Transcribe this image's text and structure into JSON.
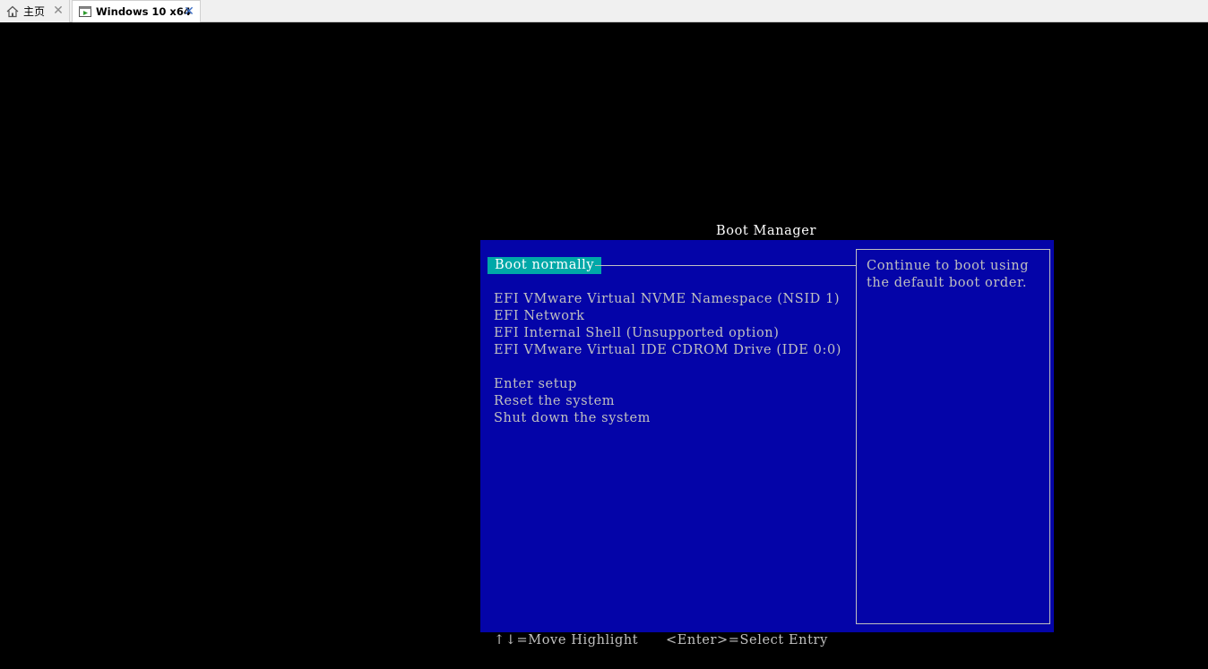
{
  "tabs": [
    {
      "label": "主页",
      "icon": "home-icon",
      "active": false
    },
    {
      "label": "Windows 10 x64",
      "icon": "vm-play-icon",
      "active": true
    }
  ],
  "tab_close_glyph": "✕",
  "boot_manager": {
    "title": "Boot Manager",
    "selected_item": "Boot normally",
    "boot_entries": [
      "EFI VMware Virtual NVME Namespace (NSID 1)",
      "EFI Network",
      "EFI Internal Shell (Unsupported option)",
      "EFI VMware Virtual IDE CDROM Drive (IDE 0:0)"
    ],
    "actions": [
      "Enter setup",
      "Reset the system",
      "Shut down the system"
    ],
    "help_text": "Continue to boot using\nthe default boot order.",
    "footer": {
      "move_hint": "↑↓=Move Highlight",
      "select_hint": "<Enter>=Select Entry"
    }
  },
  "colors": {
    "bios_background": "#0404a8",
    "highlight": "#00a8a8",
    "text": "#c0c0c0",
    "title": "#ffffff",
    "screen": "#000000"
  }
}
